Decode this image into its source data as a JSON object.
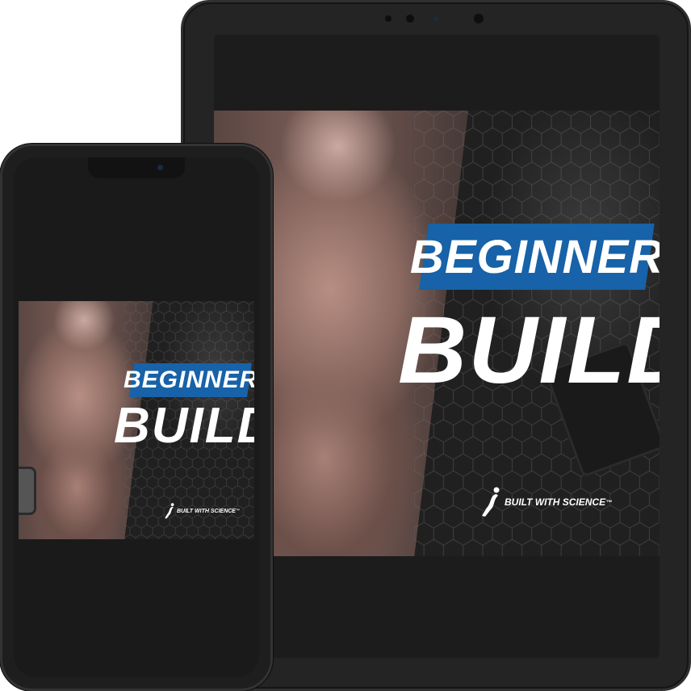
{
  "cover": {
    "title_line1": "BEGINNER",
    "title_line2": "BUILD",
    "brand": "BUILT WITH SCIENCE",
    "trademark": "™"
  },
  "colors": {
    "banner_blue": "#1762a8",
    "device_body": "#242424",
    "screen_bg": "#1c1c1c"
  },
  "icons": [
    "runner-logo-icon",
    "camera-icon"
  ]
}
